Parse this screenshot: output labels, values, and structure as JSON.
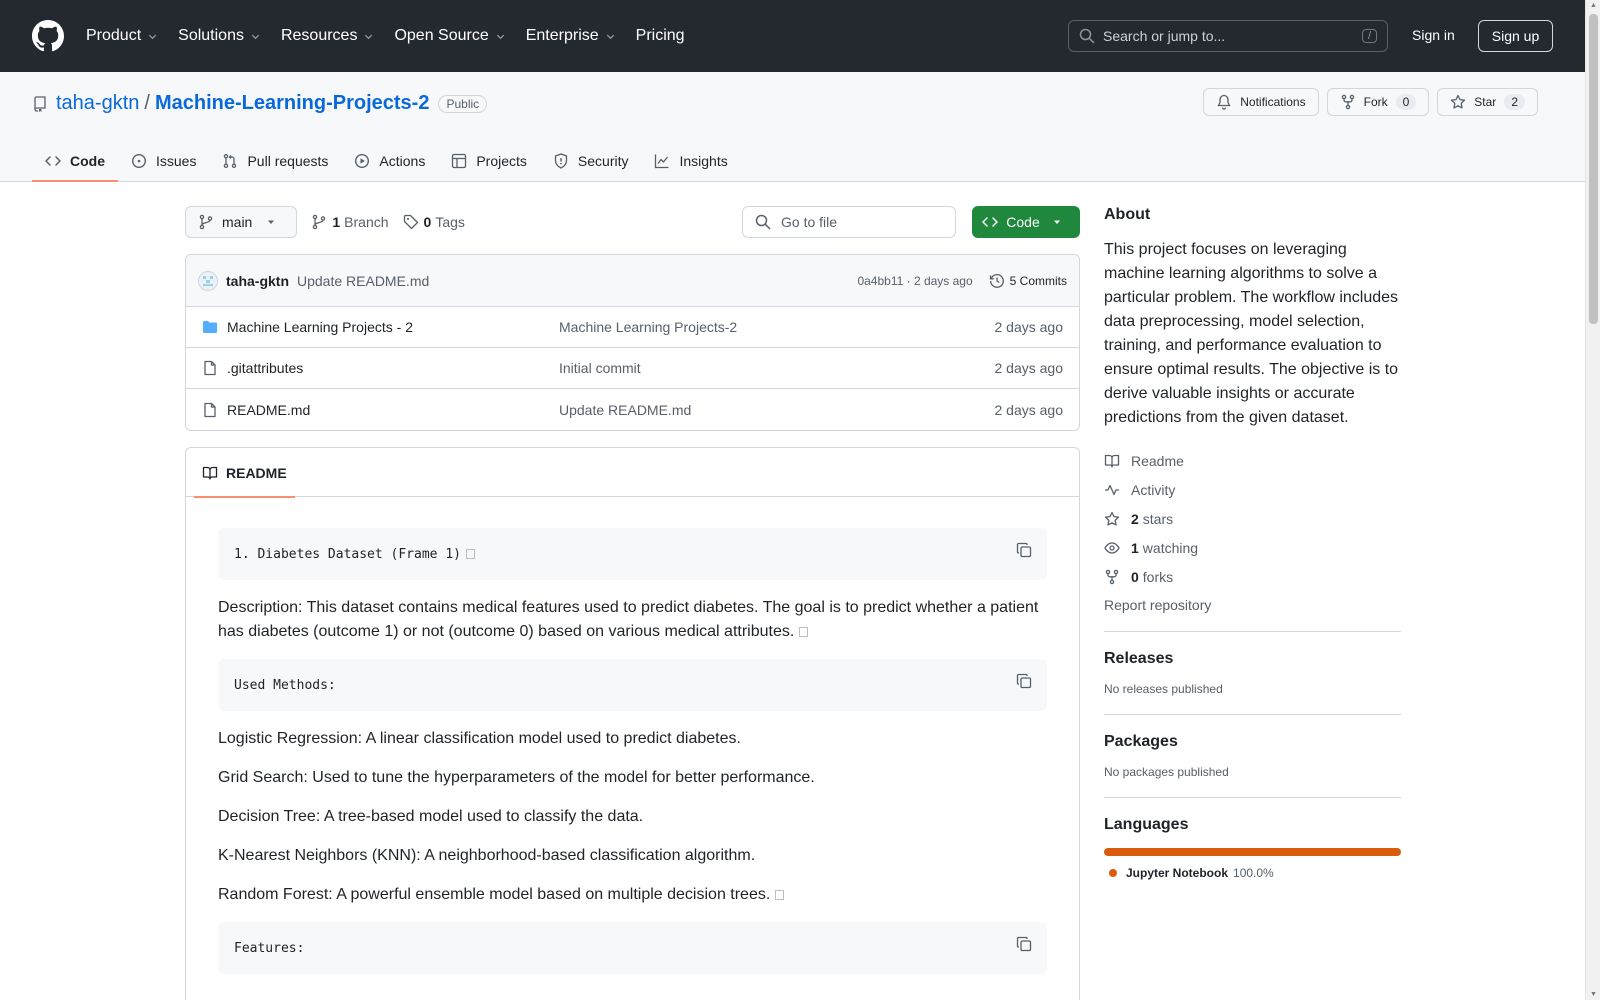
{
  "header": {
    "nav": [
      {
        "label": "Product",
        "dropdown": true
      },
      {
        "label": "Solutions",
        "dropdown": true
      },
      {
        "label": "Resources",
        "dropdown": true
      },
      {
        "label": "Open Source",
        "dropdown": true
      },
      {
        "label": "Enterprise",
        "dropdown": true
      },
      {
        "label": "Pricing",
        "dropdown": false
      }
    ],
    "search_placeholder": "Search or jump to...",
    "search_shortcut": "/",
    "sign_in": "Sign in",
    "sign_up": "Sign up"
  },
  "repo": {
    "owner": "taha-gktn",
    "separator": "/",
    "name": "Machine-Learning-Projects-2",
    "visibility": "Public",
    "notifications_label": "Notifications",
    "fork_label": "Fork",
    "fork_count": "0",
    "star_label": "Star",
    "star_count": "2",
    "tabs": [
      {
        "label": "Code",
        "icon": "code-icon",
        "active": true
      },
      {
        "label": "Issues",
        "icon": "issue-icon",
        "active": false
      },
      {
        "label": "Pull requests",
        "icon": "pull-request-icon",
        "active": false
      },
      {
        "label": "Actions",
        "icon": "play-icon",
        "active": false
      },
      {
        "label": "Projects",
        "icon": "table-icon",
        "active": false
      },
      {
        "label": "Security",
        "icon": "shield-icon",
        "active": false
      },
      {
        "label": "Insights",
        "icon": "graph-icon",
        "active": false
      }
    ]
  },
  "toolbar": {
    "branch": "main",
    "branch_count": "1",
    "branch_label": "Branch",
    "tag_count": "0",
    "tag_label": "Tags",
    "goto_placeholder": "Go to file",
    "code_button": "Code"
  },
  "latest_commit": {
    "author": "taha-gktn",
    "message": "Update README.md",
    "meta": "0a4bb11 · 2 days ago",
    "commits_label": "5 Commits"
  },
  "files": [
    {
      "name": "Machine Learning Projects - 2",
      "type": "folder",
      "commit": "Machine Learning Projects-2",
      "date": "2 days ago"
    },
    {
      "name": ".gitattributes",
      "type": "file",
      "commit": "Initial commit",
      "date": "2 days ago"
    },
    {
      "name": "README.md",
      "type": "file",
      "commit": "Update README.md",
      "date": "2 days ago"
    }
  ],
  "readme": {
    "tab_label": "README",
    "code1": "1. Diabetes Dataset (Frame 1) ",
    "description": "Description: This dataset contains medical features used to predict diabetes. The goal is to predict whether a patient has diabetes (outcome 1) or not (outcome 0) based on various medical attributes.",
    "code2": "Used Methods:",
    "methods": [
      "Logistic Regression: A linear classification model used to predict diabetes.",
      "Grid Search: Used to tune the hyperparameters of the model for better performance.",
      "Decision Tree: A tree-based model used to classify the data.",
      "K-Nearest Neighbors (KNN): A neighborhood-based classification algorithm.",
      "Random Forest: A powerful ensemble model based on multiple decision trees."
    ],
    "code3": "Features:"
  },
  "sidebar": {
    "about_title": "About",
    "about_text": "This project focuses on leveraging machine learning algorithms to solve a particular problem. The workflow includes data preprocessing, model selection, training, and performance evaluation to ensure optimal results. The objective is to derive valuable insights or accurate predictions from the given dataset.",
    "readme": "Readme",
    "activity": "Activity",
    "stars_count": "2",
    "stars_label": "stars",
    "watching_count": "1",
    "watching_label": "watching",
    "forks_count": "0",
    "forks_label": "forks",
    "report": "Report repository",
    "releases_title": "Releases",
    "releases_text": "No releases published",
    "packages_title": "Packages",
    "packages_text": "No packages published",
    "languages_title": "Languages",
    "language_name": "Jupyter Notebook",
    "language_pct": "100.0%",
    "language_color": "#DA5B0B"
  },
  "colors": {
    "header_bg": "#24292F",
    "link": "#0969DA",
    "primary_button": "#1F883D",
    "active_tab_underline": "#FD8C73"
  }
}
